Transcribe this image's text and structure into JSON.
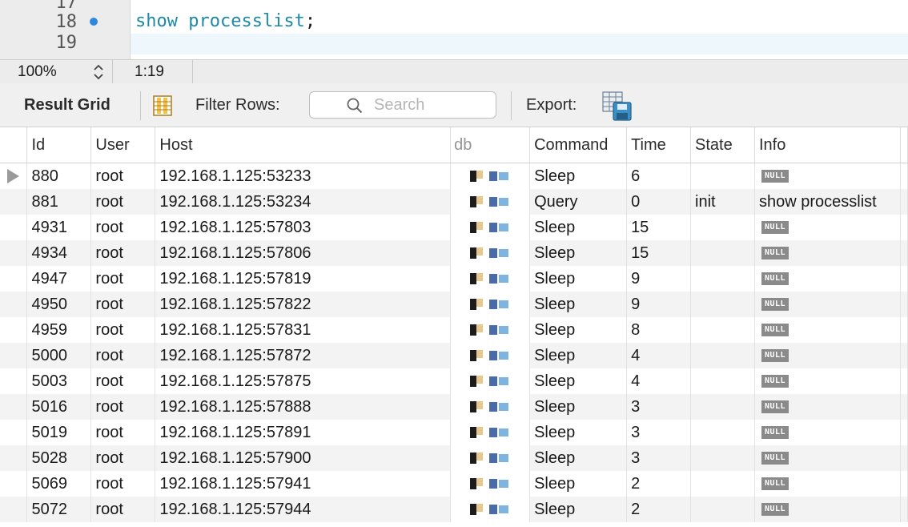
{
  "editor": {
    "lines": [
      {
        "number": "17",
        "text": ""
      },
      {
        "number": "18",
        "text": "show processlist",
        "terminator": ";",
        "breakpoint": true
      },
      {
        "number": "19",
        "text": ""
      }
    ],
    "colors": {
      "keyword": "#1e8aa6",
      "breakpoint": "#2f88e0"
    }
  },
  "statusbar": {
    "zoom": "100%",
    "cursor": "1:19"
  },
  "toolbar": {
    "result_grid_label": "Result Grid",
    "grid_icon": "grid-view-icon",
    "filter_label": "Filter Rows:",
    "search_placeholder": "Search",
    "export_label": "Export:",
    "export_icon": "export-grid-icon"
  },
  "grid": {
    "columns": [
      "Id",
      "User",
      "Host",
      "db",
      "Command",
      "Time",
      "State",
      "Info"
    ],
    "null_label": "NULL",
    "rows": [
      {
        "id": "880",
        "user": "root",
        "host": "192.168.1.125:53233",
        "command": "Sleep",
        "time": "6",
        "state": "",
        "info": null,
        "current": true
      },
      {
        "id": "881",
        "user": "root",
        "host": "192.168.1.125:53234",
        "command": "Query",
        "time": "0",
        "state": "init",
        "info": "show processlist"
      },
      {
        "id": "4931",
        "user": "root",
        "host": "192.168.1.125:57803",
        "command": "Sleep",
        "time": "15",
        "state": "",
        "info": null
      },
      {
        "id": "4934",
        "user": "root",
        "host": "192.168.1.125:57806",
        "command": "Sleep",
        "time": "15",
        "state": "",
        "info": null
      },
      {
        "id": "4947",
        "user": "root",
        "host": "192.168.1.125:57819",
        "command": "Sleep",
        "time": "9",
        "state": "",
        "info": null
      },
      {
        "id": "4950",
        "user": "root",
        "host": "192.168.1.125:57822",
        "command": "Sleep",
        "time": "9",
        "state": "",
        "info": null
      },
      {
        "id": "4959",
        "user": "root",
        "host": "192.168.1.125:57831",
        "command": "Sleep",
        "time": "8",
        "state": "",
        "info": null
      },
      {
        "id": "5000",
        "user": "root",
        "host": "192.168.1.125:57872",
        "command": "Sleep",
        "time": "4",
        "state": "",
        "info": null
      },
      {
        "id": "5003",
        "user": "root",
        "host": "192.168.1.125:57875",
        "command": "Sleep",
        "time": "4",
        "state": "",
        "info": null
      },
      {
        "id": "5016",
        "user": "root",
        "host": "192.168.1.125:57888",
        "command": "Sleep",
        "time": "3",
        "state": "",
        "info": null
      },
      {
        "id": "5019",
        "user": "root",
        "host": "192.168.1.125:57891",
        "command": "Sleep",
        "time": "3",
        "state": "",
        "info": null
      },
      {
        "id": "5028",
        "user": "root",
        "host": "192.168.1.125:57900",
        "command": "Sleep",
        "time": "3",
        "state": "",
        "info": null
      },
      {
        "id": "5069",
        "user": "root",
        "host": "192.168.1.125:57941",
        "command": "Sleep",
        "time": "2",
        "state": "",
        "info": null
      },
      {
        "id": "5072",
        "user": "root",
        "host": "192.168.1.125:57944",
        "command": "Sleep",
        "time": "2",
        "state": "",
        "info": null
      }
    ]
  }
}
